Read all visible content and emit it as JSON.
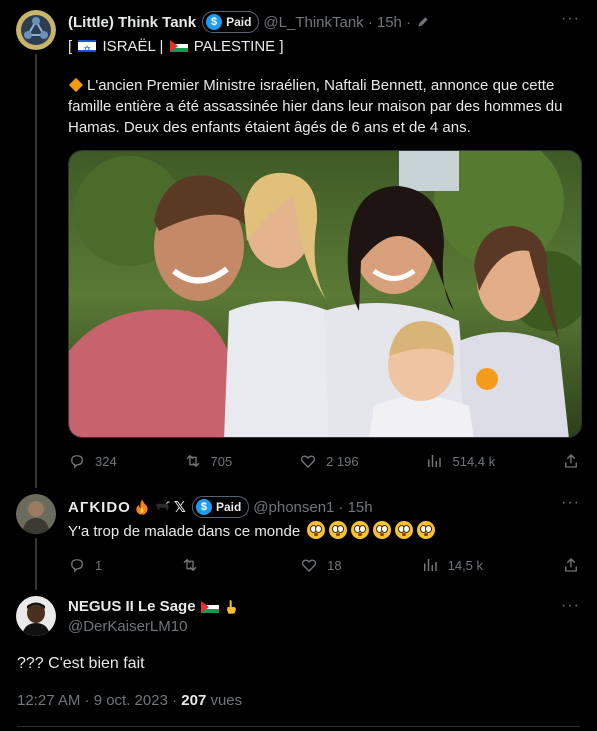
{
  "tweet1": {
    "name": "(Little) Think Tank",
    "paid_label": "Paid",
    "paid_symbol": "$",
    "handle": "@L_ThinkTank",
    "time": "· 15h ·",
    "tags_line": {
      "open": "[",
      "israel": "ISRAËL",
      "sep": "|",
      "palestine": "PALESTINE",
      "close": "]"
    },
    "body": "L'ancien Premier Ministre israélien, Naftali Bennett, annonce que cette famille entière a été assassinée hier dans leur maison par des hommes du Hamas. Deux des enfants étaient âgés de 6 ans et de 4 ans.",
    "stats": {
      "replies": "324",
      "reposts": "705",
      "likes": "2 196",
      "views": "514,4 k"
    }
  },
  "tweet2": {
    "name": "AГKIDO",
    "name_suffix": "𝕏",
    "paid_label": "Paid",
    "paid_symbol": "$",
    "handle": "@phonsen1",
    "time": "· 15h",
    "body": "Y'a trop de malade dans ce monde",
    "stats": {
      "replies": "1",
      "reposts": "",
      "likes": "18",
      "views": "14,5 k"
    }
  },
  "tweet3": {
    "name": "NEGUS II Le Sage",
    "handle": "@DerKaiserLM10",
    "body": "??? C'est bien fait",
    "timestamp": "12:27 AM · 9 oct. 2023 ·",
    "views_count": "207",
    "views_label": "vues"
  },
  "colors": {
    "background": "#000000",
    "text": "#e7e9ea",
    "muted": "#71767b",
    "accent": "#1d9bf0"
  }
}
